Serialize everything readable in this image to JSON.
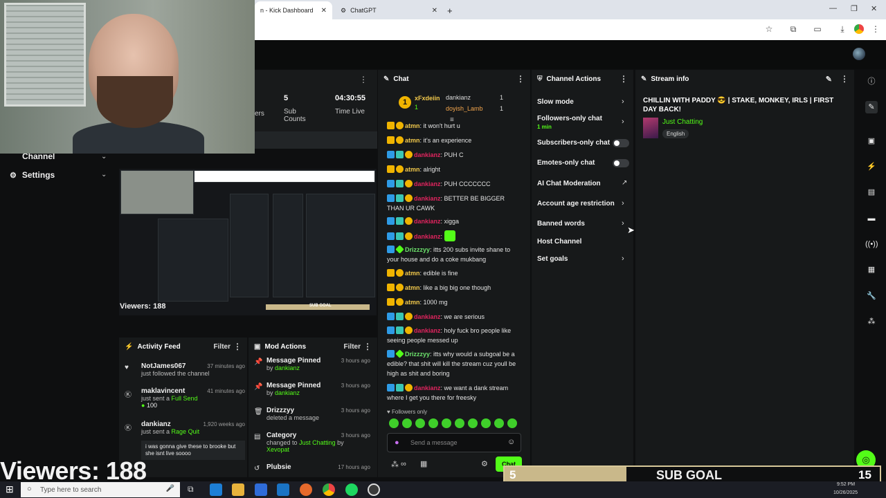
{
  "browser": {
    "tabs": [
      {
        "label": "n - Kick Dashboard",
        "active": true
      },
      {
        "label": "ChatGPT",
        "active": false
      }
    ],
    "new_tab": "+"
  },
  "sidebar": {
    "channel": "Channel",
    "settings": "Settings"
  },
  "stats": {
    "subs_value": "5",
    "subs_label": "Sub\nCounts",
    "time_value": "04:30:55",
    "time_label": "Time Live",
    "partial_label": "ers"
  },
  "preview": {
    "viewers": "Viewers: 188",
    "subgoal": "SUB GOAL",
    "subgoal_count": "15"
  },
  "activity_feed": {
    "title": "Activity Feed",
    "filter": "Filter",
    "items": [
      {
        "name": "NotJames067",
        "time": "37 minutes ago",
        "action": "just followed the channel"
      },
      {
        "name": "maklavincent",
        "time": "41 minutes ago",
        "action": "just sent a",
        "highlight": "Full Send",
        "amount": "100"
      },
      {
        "name": "dankianz",
        "time": "1,920 weeks ago",
        "action": "just sent a",
        "highlight": "Rage Quit",
        "message": "i was gonna give these to brooke but she isnt live soooo"
      }
    ]
  },
  "mod_actions": {
    "title": "Mod Actions",
    "filter": "Filter",
    "items": [
      {
        "title": "Message Pinned",
        "by": "by",
        "who": "dankianz",
        "time": "3 hours ago"
      },
      {
        "title": "Message Pinned",
        "by": "by",
        "who": "dankianz",
        "time": "3 hours ago"
      },
      {
        "title": "Drizzzyy",
        "detail": "deleted a message",
        "time": "3 hours ago"
      },
      {
        "title": "Category",
        "detail": "changed to",
        "highlight": "Just Chatting",
        "by": "by",
        "who": "Xevopat",
        "time": "3 hours ago"
      },
      {
        "title": "Plubsie",
        "time": "17 hours ago"
      }
    ]
  },
  "chat": {
    "title": "Chat",
    "top_gifters": [
      {
        "name": "xFxdeiin",
        "count": "1"
      },
      {
        "name": "dankianz",
        "count": "1"
      },
      {
        "name": "doyish_Lamb",
        "count": "1"
      }
    ],
    "rank": "1",
    "messages": [
      {
        "user": "atmn",
        "text": "it won't hurt u",
        "badges": [
          "crown",
          "one"
        ],
        "style": "atmn"
      },
      {
        "user": "atmn",
        "text": "it's an experience",
        "badges": [
          "crown",
          "one"
        ],
        "style": "atmn"
      },
      {
        "user": "dankianz",
        "text": "PUH C",
        "badges": [
          "bolt",
          "sub",
          "one"
        ],
        "style": "dank"
      },
      {
        "user": "atmn",
        "text": "alright",
        "badges": [
          "crown",
          "one"
        ],
        "style": "atmn"
      },
      {
        "user": "dankianz",
        "text": "PUH CCCCCCC",
        "badges": [
          "bolt",
          "sub",
          "one"
        ],
        "style": "dank"
      },
      {
        "user": "dankianz",
        "text": "BETTER BE BIGGER THAN UR CAWK",
        "badges": [
          "bolt",
          "sub",
          "one"
        ],
        "style": "dank"
      },
      {
        "user": "dankianz",
        "text": "xigga",
        "badges": [
          "bolt",
          "sub",
          "one"
        ],
        "style": "dank"
      },
      {
        "user": "dankianz",
        "text": "",
        "badges": [
          "bolt",
          "sub",
          "one"
        ],
        "style": "dank",
        "emote": true
      },
      {
        "user": "Drizzzyy",
        "text": "itts 200 subs invite shane to your house and do a coke mukbang",
        "badges": [
          "bolt",
          "star"
        ],
        "style": "drizz"
      },
      {
        "user": "atmn",
        "text": "edible is fine",
        "badges": [
          "crown",
          "one"
        ],
        "style": "atmn"
      },
      {
        "user": "atmn",
        "text": "like a big big one though",
        "badges": [
          "crown",
          "one"
        ],
        "style": "atmn"
      },
      {
        "user": "atmn",
        "text": "1000 mg",
        "badges": [
          "crown",
          "one"
        ],
        "style": "atmn"
      },
      {
        "user": "dankianz",
        "text": "we are serious",
        "badges": [
          "bolt",
          "sub",
          "one"
        ],
        "style": "dank"
      },
      {
        "user": "dankianz",
        "text": "holy fuck bro people like seeing people messed up",
        "badges": [
          "bolt",
          "sub",
          "one"
        ],
        "style": "dank"
      },
      {
        "user": "Drizzzyy",
        "text": "itts why would a subgoal be a edible? that shit will kill the stream cuz youll be high as shit and boring",
        "badges": [
          "bolt",
          "star"
        ],
        "style": "drizz"
      },
      {
        "user": "dankianz",
        "text": "we want a dank stream where I get you there for freesky",
        "badges": [
          "bolt",
          "sub",
          "one"
        ],
        "style": "dank"
      }
    ],
    "followers_only": "Followers only",
    "placeholder": "Send a message",
    "send": "Chat"
  },
  "channel_actions": {
    "title": "Channel Actions",
    "items": [
      {
        "label": "Slow mode",
        "kind": "chevron"
      },
      {
        "label": "Followers-only chat",
        "sub": "1 min",
        "kind": "chevron"
      },
      {
        "label": "Subscribers-only chat",
        "kind": "toggle"
      },
      {
        "label": "Emotes-only chat",
        "kind": "toggle"
      },
      {
        "label": "AI Chat Moderation",
        "kind": "external"
      },
      {
        "label": "Account age restriction",
        "kind": "chevron"
      },
      {
        "label": "Banned words",
        "kind": "chevron"
      },
      {
        "label": "Host Channel",
        "kind": "none"
      },
      {
        "label": "Set goals",
        "kind": "chevron"
      }
    ]
  },
  "stream_info": {
    "title": "Stream info",
    "stream_title": "CHILLIN WITH PADDY 😎 | STAKE, MONKEY, IRLS | FIRST DAY BACK!",
    "category": "Just Chatting",
    "language": "English"
  },
  "overlay": {
    "viewers": "Viewers: 188",
    "subgoal_current": "5",
    "subgoal_label": "SUB GOAL",
    "subgoal_target": "15",
    "subgoal_progress": 0.33
  },
  "taskbar": {
    "search_placeholder": "Type here to search",
    "time": "9:52 PM",
    "date": "10/26/2025"
  },
  "colors": {
    "accent": "#53fc18",
    "danger": "#e0245e",
    "gold": "#f0b400"
  }
}
